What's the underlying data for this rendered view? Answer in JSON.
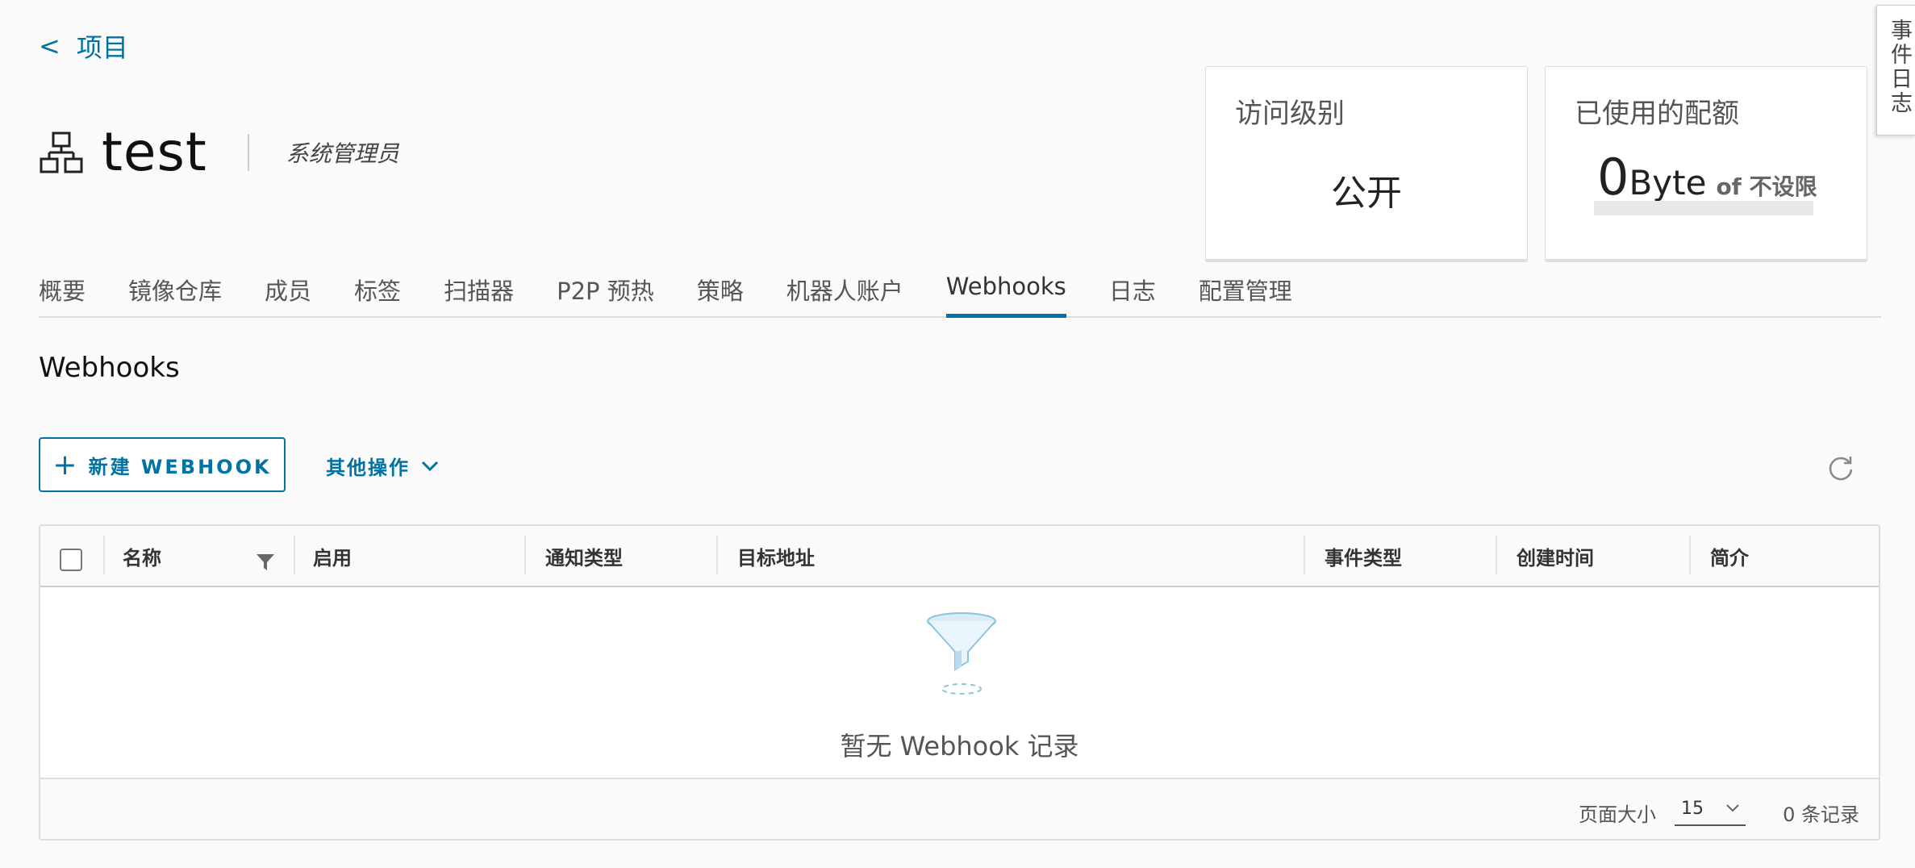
{
  "back": {
    "label": "项目",
    "chevron": "<"
  },
  "project": {
    "title": "test",
    "role": "系统管理员"
  },
  "cards": {
    "access": {
      "title": "访问级别",
      "value": "公开"
    },
    "quota": {
      "title": "已使用的配额",
      "used": "0",
      "unit": "Byte",
      "of": "of 不设限",
      "fraction": 0
    }
  },
  "side_tab": {
    "label": "事件日志"
  },
  "tabs": [
    {
      "label": "概要",
      "active": false
    },
    {
      "label": "镜像仓库",
      "active": false
    },
    {
      "label": "成员",
      "active": false
    },
    {
      "label": "标签",
      "active": false
    },
    {
      "label": "扫描器",
      "active": false
    },
    {
      "label": "P2P 预热",
      "active": false
    },
    {
      "label": "策略",
      "active": false
    },
    {
      "label": "机器人账户",
      "active": false
    },
    {
      "label": "Webhooks",
      "active": true
    },
    {
      "label": "日志",
      "active": false
    },
    {
      "label": "配置管理",
      "active": false
    }
  ],
  "section": {
    "title": "Webhooks"
  },
  "toolbar": {
    "new_label": "新建 WEBHOOK",
    "new_icon": "plus-icon",
    "more_label": "其他操作",
    "refresh_icon": "refresh-icon"
  },
  "grid": {
    "columns": [
      "名称",
      "启用",
      "通知类型",
      "目标地址",
      "事件类型",
      "创建时间",
      "简介"
    ],
    "empty_text": "暂无 Webhook 记录",
    "footer": {
      "page_size_label": "页面大小",
      "page_size": "15",
      "count_text": "0 条记录"
    }
  },
  "colors": {
    "accent": "#0072a3",
    "background": "#fafafa"
  }
}
